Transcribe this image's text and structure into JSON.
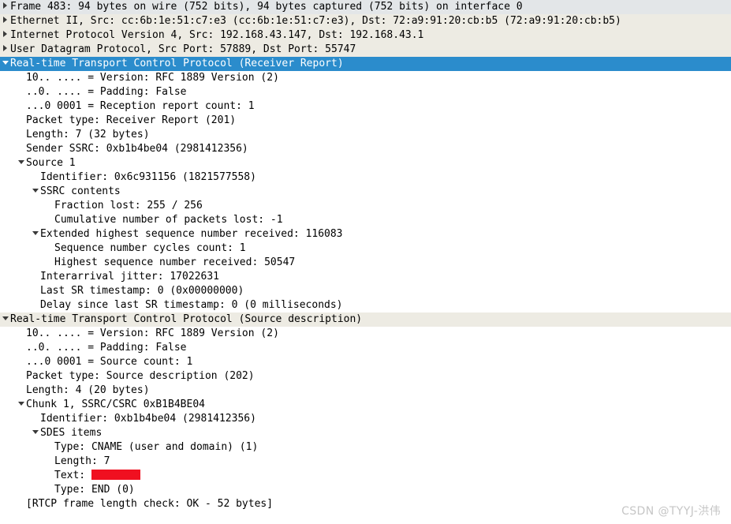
{
  "app": "wireshark-packet-details",
  "colors": {
    "selected_row_bg": "#2b8ccc",
    "selected_row_fg": "#ffffff",
    "row_gray_bg": "#e3e6e8",
    "row_beige_bg": "#edebe3",
    "row_white_bg": "#ffffff",
    "redaction": "#f01020",
    "watermark": "#c6c6c6"
  },
  "icons": {
    "collapsed": "triangle-right-icon",
    "expanded": "triangle-down-icon"
  },
  "watermark": {
    "text": "CSDN @TYYJ-洪伟"
  },
  "tree": {
    "rows": [
      {
        "text": "Frame 483: 94 bytes on wire (752 bits), 94 bytes captured (752 bits) on interface 0",
        "indent": 0,
        "toggle": "collapsed",
        "bg": "gray",
        "name": "tree-row-frame"
      },
      {
        "text": "Ethernet II, Src: cc:6b:1e:51:c7:e3 (cc:6b:1e:51:c7:e3), Dst: 72:a9:91:20:cb:b5 (72:a9:91:20:cb:b5)",
        "indent": 0,
        "toggle": "collapsed",
        "bg": "beige",
        "name": "tree-row-ethernet"
      },
      {
        "text": "Internet Protocol Version 4, Src: 192.168.43.147, Dst: 192.168.43.1",
        "indent": 0,
        "toggle": "collapsed",
        "bg": "beige",
        "name": "tree-row-ipv4"
      },
      {
        "text": "User Datagram Protocol, Src Port: 57889, Dst Port: 55747",
        "indent": 0,
        "toggle": "collapsed",
        "bg": "beige",
        "name": "tree-row-udp"
      },
      {
        "text": "Real-time Transport Control Protocol (Receiver Report)",
        "indent": 0,
        "toggle": "expanded",
        "bg": "sel",
        "name": "tree-row-rtcp-receiver-report"
      },
      {
        "text": "10.. .... = Version: RFC 1889 Version (2)",
        "indent": 1,
        "toggle": "none",
        "bg": "white",
        "name": "tree-row-rr-version"
      },
      {
        "text": "..0. .... = Padding: False",
        "indent": 1,
        "toggle": "none",
        "bg": "white",
        "name": "tree-row-rr-padding"
      },
      {
        "text": "...0 0001 = Reception report count: 1",
        "indent": 1,
        "toggle": "none",
        "bg": "white",
        "name": "tree-row-rr-reception-report-count"
      },
      {
        "text": "Packet type: Receiver Report (201)",
        "indent": 1,
        "toggle": "none",
        "bg": "white",
        "name": "tree-row-rr-packet-type"
      },
      {
        "text": "Length: 7 (32 bytes)",
        "indent": 1,
        "toggle": "none",
        "bg": "white",
        "name": "tree-row-rr-length"
      },
      {
        "text": "Sender SSRC: 0xb1b4be04 (2981412356)",
        "indent": 1,
        "toggle": "none",
        "bg": "white",
        "name": "tree-row-rr-sender-ssrc"
      },
      {
        "text": "Source 1",
        "indent": 1,
        "toggle": "expanded",
        "bg": "white",
        "name": "tree-row-rr-source-1"
      },
      {
        "text": "Identifier: 0x6c931156 (1821577558)",
        "indent": 2,
        "toggle": "none",
        "bg": "white",
        "name": "tree-row-rr-source-identifier"
      },
      {
        "text": "SSRC contents",
        "indent": 2,
        "toggle": "expanded",
        "bg": "white",
        "name": "tree-row-rr-ssrc-contents"
      },
      {
        "text": "Fraction lost: 255 / 256",
        "indent": 3,
        "toggle": "none",
        "bg": "white",
        "name": "tree-row-rr-fraction-lost"
      },
      {
        "text": "Cumulative number of packets lost: -1",
        "indent": 3,
        "toggle": "none",
        "bg": "white",
        "name": "tree-row-rr-cumulative-lost"
      },
      {
        "text": "Extended highest sequence number received: 116083",
        "indent": 2,
        "toggle": "expanded",
        "bg": "white",
        "name": "tree-row-rr-extended-highest-seq"
      },
      {
        "text": "Sequence number cycles count: 1",
        "indent": 3,
        "toggle": "none",
        "bg": "white",
        "name": "tree-row-rr-seq-cycles-count"
      },
      {
        "text": "Highest sequence number received: 50547",
        "indent": 3,
        "toggle": "none",
        "bg": "white",
        "name": "tree-row-rr-highest-seq-received"
      },
      {
        "text": "Interarrival jitter: 17022631",
        "indent": 2,
        "toggle": "none",
        "bg": "white",
        "name": "tree-row-rr-interarrival-jitter"
      },
      {
        "text": "Last SR timestamp: 0 (0x00000000)",
        "indent": 2,
        "toggle": "none",
        "bg": "white",
        "name": "tree-row-rr-last-sr-timestamp"
      },
      {
        "text": "Delay since last SR timestamp: 0 (0 milliseconds)",
        "indent": 2,
        "toggle": "none",
        "bg": "white",
        "name": "tree-row-rr-delay-since-last-sr"
      },
      {
        "text": "Real-time Transport Control Protocol (Source description)",
        "indent": 0,
        "toggle": "expanded",
        "bg": "beige",
        "name": "tree-row-rtcp-source-description"
      },
      {
        "text": "10.. .... = Version: RFC 1889 Version (2)",
        "indent": 1,
        "toggle": "none",
        "bg": "white",
        "name": "tree-row-sd-version"
      },
      {
        "text": "..0. .... = Padding: False",
        "indent": 1,
        "toggle": "none",
        "bg": "white",
        "name": "tree-row-sd-padding"
      },
      {
        "text": "...0 0001 = Source count: 1",
        "indent": 1,
        "toggle": "none",
        "bg": "white",
        "name": "tree-row-sd-source-count"
      },
      {
        "text": "Packet type: Source description (202)",
        "indent": 1,
        "toggle": "none",
        "bg": "white",
        "name": "tree-row-sd-packet-type"
      },
      {
        "text": "Length: 4 (20 bytes)",
        "indent": 1,
        "toggle": "none",
        "bg": "white",
        "name": "tree-row-sd-length"
      },
      {
        "text": "Chunk 1, SSRC/CSRC 0xB1B4BE04",
        "indent": 1,
        "toggle": "expanded",
        "bg": "white",
        "name": "tree-row-sd-chunk-1"
      },
      {
        "text": "Identifier: 0xb1b4be04 (2981412356)",
        "indent": 2,
        "toggle": "none",
        "bg": "white",
        "name": "tree-row-sd-chunk-identifier"
      },
      {
        "text": "SDES items",
        "indent": 2,
        "toggle": "expanded",
        "bg": "white",
        "name": "tree-row-sdes-items"
      },
      {
        "text": "Type: CNAME (user and domain) (1)",
        "indent": 3,
        "toggle": "none",
        "bg": "white",
        "name": "tree-row-sdes-type-cname"
      },
      {
        "text": "Length: 7",
        "indent": 3,
        "toggle": "none",
        "bg": "white",
        "name": "tree-row-sdes-length"
      },
      {
        "text": "Text: ",
        "indent": 3,
        "toggle": "none",
        "bg": "white",
        "redacted": true,
        "name": "tree-row-sdes-text"
      },
      {
        "text": "Type: END (0)",
        "indent": 3,
        "toggle": "none",
        "bg": "white",
        "name": "tree-row-sdes-type-end"
      },
      {
        "text": "[RTCP frame length check: OK - 52 bytes]",
        "indent": 1,
        "toggle": "none",
        "bg": "white",
        "name": "tree-row-rtcp-frame-length-check"
      }
    ]
  }
}
